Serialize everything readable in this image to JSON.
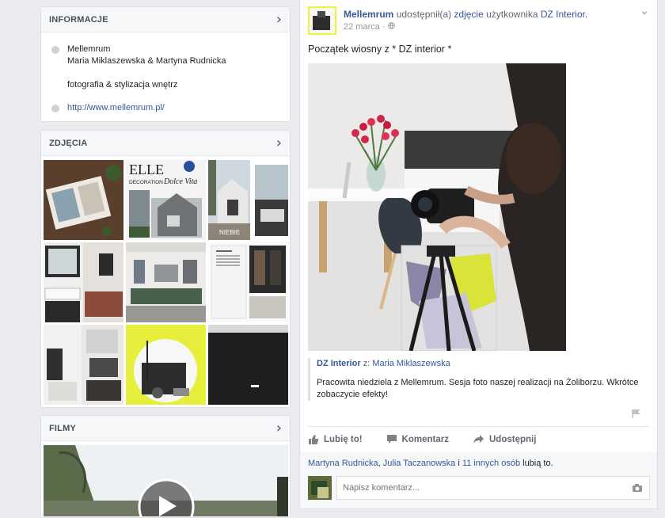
{
  "info": {
    "title": "INFORMACJE",
    "name_line1": "Mellemrum",
    "name_line2": "Maria Miklaszewska & Martyna Rudnicka",
    "description": "fotografia & stylizacja wnętrz",
    "website": "http://www.mellemrum.pl/"
  },
  "photos": {
    "title": "ZDJĘCIA",
    "elle_brand": "ELLE",
    "elle_sub": "DECORATION",
    "elle_dolce": "Dolce Vita",
    "niebie": "NIEBIE"
  },
  "videos": {
    "title": "FILMY"
  },
  "post": {
    "author": "Mellemrum",
    "shared_text": "udostępnił(a)",
    "shared_link": "zdjęcie",
    "shared_of": "użytkownika",
    "source_page": "DZ Interior.",
    "date": "22 marca",
    "date_sep": "·",
    "message": "Początek wiosny z * DZ interior *",
    "attribution_page": "DZ Interior",
    "attribution_by": "z:",
    "attribution_user": "Maria Miklaszewska",
    "attribution_text": "Pracowita niedziela z Mellemrum. Sesja foto naszej realizacji na Żoliborzu. Wkrótce zobaczycie efekty!"
  },
  "actions": {
    "like": "Lubię to!",
    "comment": "Komentarz",
    "share": "Udostępnij"
  },
  "likes": {
    "user1": "Martyna Rudnicka",
    "sep": ",",
    "user2": "Julia Taczanowska",
    "and": "i",
    "others": "11 innych osób",
    "suffix": "lubią to."
  },
  "comment_box": {
    "placeholder": "Napisz komentarz..."
  },
  "colors": {
    "link": "#365899",
    "background": "#e9ebee",
    "border": "#dddfe2"
  }
}
